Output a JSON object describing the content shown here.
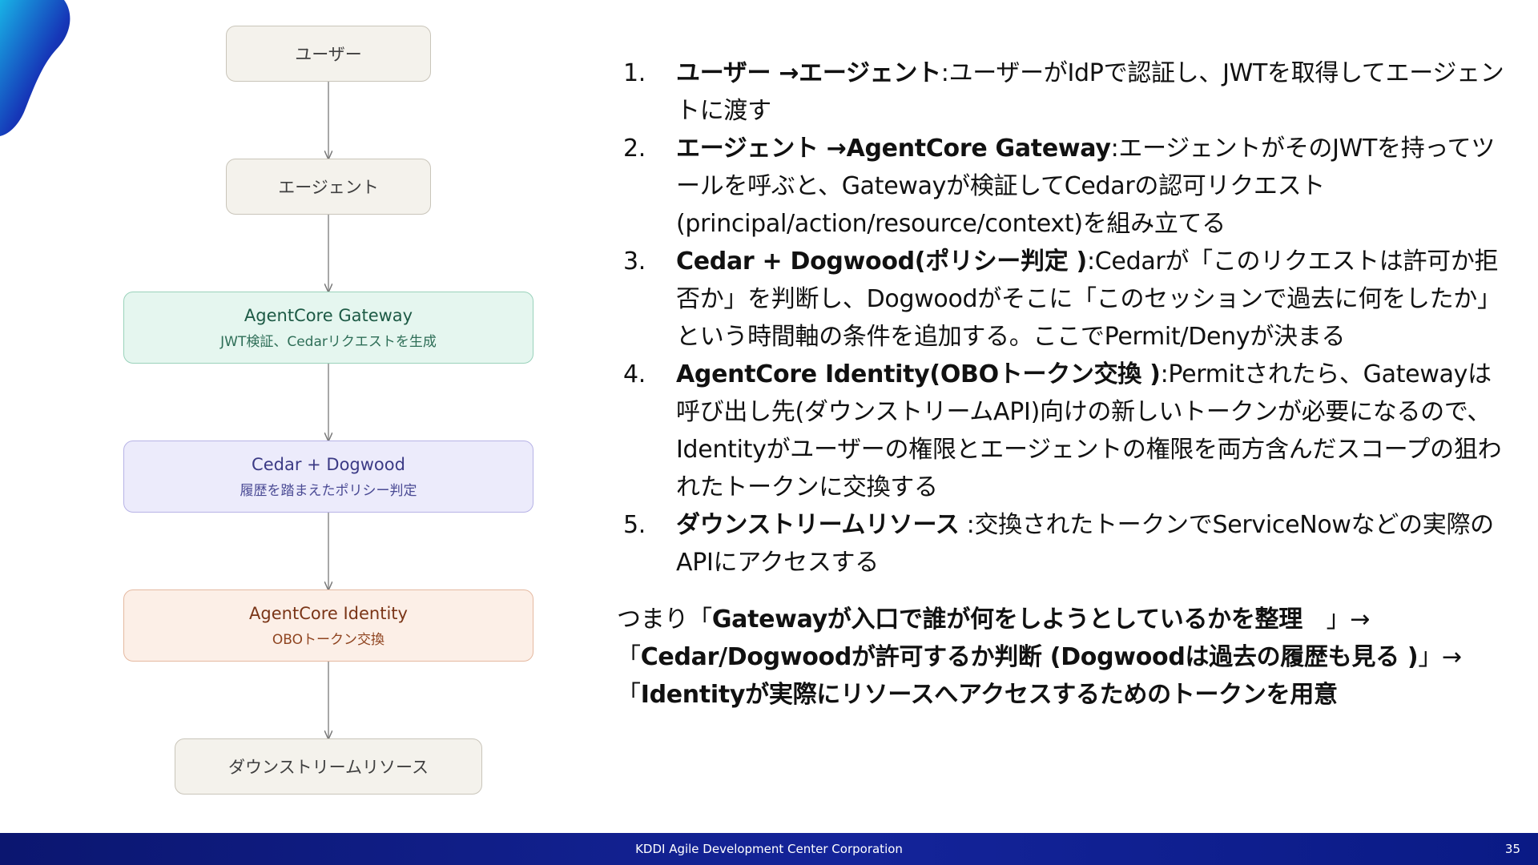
{
  "colors": {
    "footer": "#0b1670",
    "blob": "#0a1a85",
    "gateway_fill": "#e5f6ef",
    "cedar_fill": "#ecebfb",
    "identity_fill": "#fcefe7",
    "plain_fill": "#f4f2ec"
  },
  "diagram": {
    "nodes": [
      {
        "id": "user",
        "title": "ユーザー",
        "subtitle": ""
      },
      {
        "id": "agent",
        "title": "エージェント",
        "subtitle": ""
      },
      {
        "id": "gateway",
        "title": "AgentCore Gateway",
        "subtitle": "JWT検証、Cedarリクエストを生成"
      },
      {
        "id": "cedar",
        "title": "Cedar + Dogwood",
        "subtitle": "履歴を踏まえたポリシー判定"
      },
      {
        "id": "identity",
        "title": "AgentCore Identity",
        "subtitle": "OBOトークン交換"
      },
      {
        "id": "downstream",
        "title": "ダウンストリームリソース",
        "subtitle": ""
      }
    ]
  },
  "steps": [
    {
      "num": "1.",
      "bold": "ユーザー →エージェント",
      "text": ":ユーザーがIdPで認証し、JWTを取得してエージェントに渡す"
    },
    {
      "num": "2.",
      "bold": "エージェント →AgentCore Gateway",
      "text": ":エージェントがそのJWTを持ってツールを呼ぶと、Gatewayが検証してCedarの認可リクエスト(principal/action/resource/context)を組み立てる"
    },
    {
      "num": "3.",
      "bold": "Cedar + Dogwood(ポリシー判定 )",
      "text": ":Cedarが「このリクエストは許可か拒否か」を判断し、Dogwoodがそこに「このセッションで過去に何をしたか」という時間軸の条件を追加する。ここでPermit/Denyが決まる"
    },
    {
      "num": "4.",
      "bold": "AgentCore Identity(OBOトークン交換 )",
      "text": ":Permitされたら、Gatewayは呼び出し先(ダウンストリームAPI)向けの新しいトークンが必要になるので、Identityがユーザーの権限とエージェントの権限を両方含んだスコープの狙われたトークンに交換する"
    },
    {
      "num": "5.",
      "bold": "ダウンストリームリソース",
      "text": " :交換されたトークンでServiceNowなどの実際のAPIにアクセスする"
    }
  ],
  "summary": {
    "line1_prefix": "つまり「",
    "line1_bold": "Gatewayが入口で誰が何をしようとしているかを整理",
    "line1_suffix": "　」→",
    "line2_prefix": "「",
    "line2_bold": "Cedar/Dogwoodが許可するか判断 (Dogwoodは過去の履歴も見る )",
    "line2_suffix": "」→",
    "line3_prefix": "「",
    "line3_bold": "Identityが実際にリソースへアクセスするためのトークンを用意"
  },
  "footer": {
    "company": "KDDI Agile Development Center Corporation",
    "page": "35"
  }
}
